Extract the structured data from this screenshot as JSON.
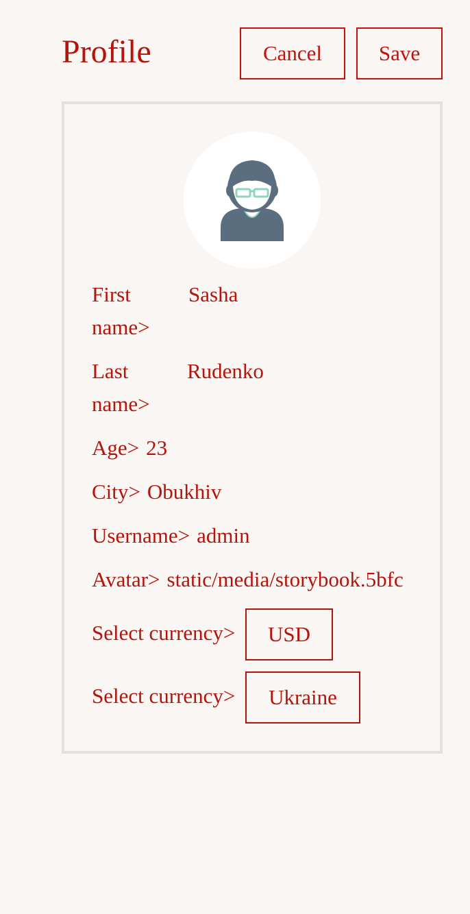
{
  "header": {
    "title": "Profile",
    "cancel_label": "Cancel",
    "save_label": "Save"
  },
  "avatar": {
    "icon": "user-avatar-with-glasses-icon"
  },
  "fields": {
    "first_name": {
      "label": "First name>",
      "value": "Sasha"
    },
    "last_name": {
      "label": "Last name>",
      "value": "Rudenko"
    },
    "age": {
      "label": "Age>",
      "value": "23"
    },
    "city": {
      "label": "City>",
      "value": "Obukhiv"
    },
    "username": {
      "label": "Username>",
      "value": "admin"
    },
    "avatar": {
      "label": "Avatar>",
      "value": "static/media/storybook.5bfc"
    },
    "currency": {
      "label": "Select currency>",
      "value": "USD"
    },
    "country": {
      "label": "Select currency>",
      "value": "Ukraine"
    }
  },
  "colors": {
    "accent": "#b3140b",
    "button_border": "#c8100a",
    "background": "#faf6f3",
    "card_border": "#e3dfdb",
    "avatar_bg": "#ffffff",
    "avatar_icon": "#5b6e80",
    "glasses": "#8fd3c1"
  }
}
